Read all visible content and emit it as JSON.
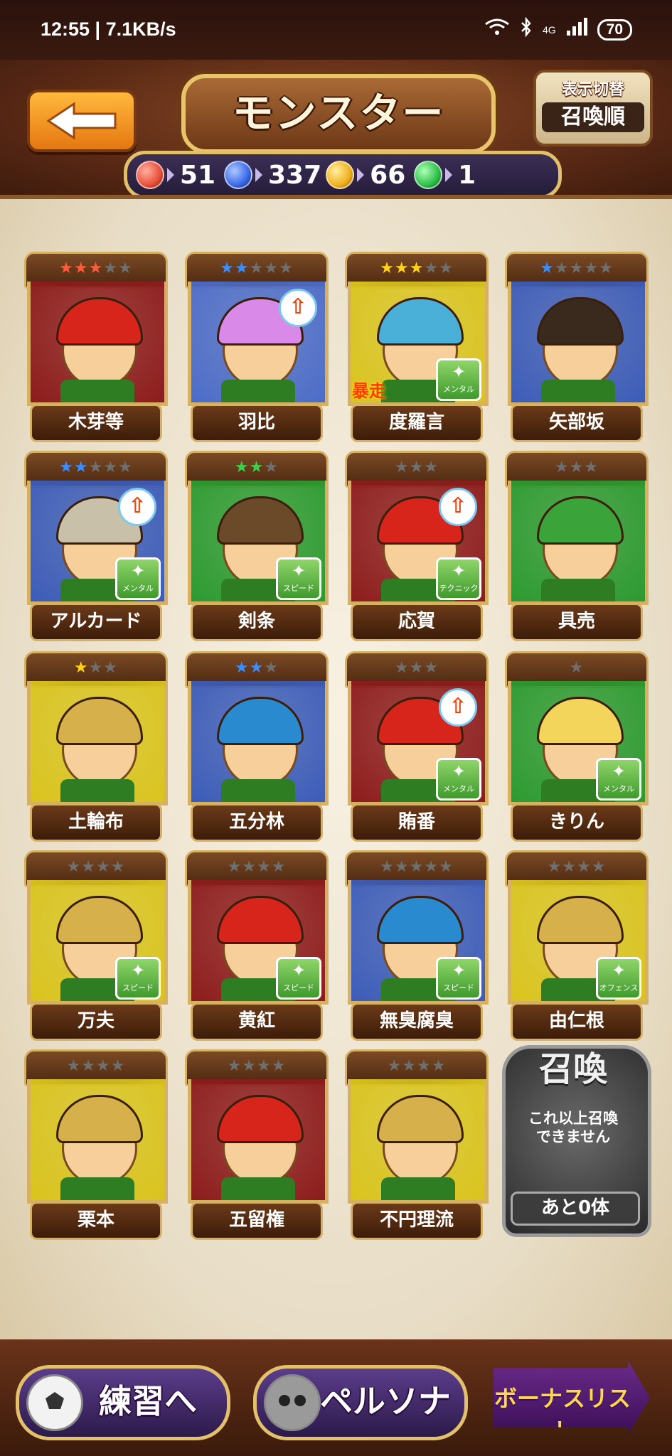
{
  "status_bar": {
    "time": "12:55 | 7.1KB/s",
    "battery": "70",
    "network": "4G"
  },
  "header": {
    "title": "モンスター",
    "sort_label_small": "表示切替",
    "sort_label_big": "召喚順"
  },
  "currencies": [
    {
      "value": "51",
      "color": "#e8503a"
    },
    {
      "value": "337",
      "color": "#3a6ae8"
    },
    {
      "value": "66",
      "color": "#f0b020"
    },
    {
      "value": "1",
      "color": "#2ec04a"
    }
  ],
  "monsters": [
    {
      "name": "木芽等",
      "stars_filled": 3,
      "stars_total": 5,
      "star_color": "#ff5a3a",
      "bg": "#8c1c1c",
      "hair": "#d8251c"
    },
    {
      "name": "羽比",
      "stars_filled": 2,
      "stars_total": 5,
      "star_color": "#3a8cff",
      "bg": "#4c6cc8",
      "hair": "#d98ae8",
      "up": true
    },
    {
      "name": "度羅言",
      "stars_filled": 3,
      "stars_total": 5,
      "star_color": "#ffd21a",
      "bg": "#d9c41e",
      "hair": "#4ab0d8",
      "skill": "メンタル",
      "rampage": "暴走"
    },
    {
      "name": "矢部坂",
      "stars_filled": 1,
      "stars_total": 5,
      "star_color": "#3a8cff",
      "bg": "#3c5cb8",
      "hair": "#3a2a1e"
    },
    {
      "name": "アルカード",
      "stars_filled": 2,
      "stars_total": 5,
      "star_color": "#3a8cff",
      "bg": "#3c5cb8",
      "hair": "#c8c0a8",
      "up": true,
      "skill": "メンタル"
    },
    {
      "name": "剣条",
      "stars_filled": 2,
      "stars_total": 3,
      "star_color": "#3ad24a",
      "bg": "#2c9a30",
      "hair": "#6b4a2a",
      "skill": "スピード"
    },
    {
      "name": "応賀",
      "stars_filled": 0,
      "stars_total": 3,
      "star_color": "#888888",
      "bg": "#8c1c1c",
      "hair": "#d8251c",
      "up": true,
      "skill": "テクニック"
    },
    {
      "name": "具売",
      "stars_filled": 0,
      "stars_total": 3,
      "star_color": "#888888",
      "bg": "#2c9a30",
      "hair": "#3aa43a"
    },
    {
      "name": "土輪布",
      "stars_filled": 1,
      "stars_total": 3,
      "star_color": "#ffd21a",
      "bg": "#d9c41e",
      "hair": "#d6b04a"
    },
    {
      "name": "五分林",
      "stars_filled": 2,
      "stars_total": 3,
      "star_color": "#3a8cff",
      "bg": "#3c5cb8",
      "hair": "#2a8ad0"
    },
    {
      "name": "賄番",
      "stars_filled": 0,
      "stars_total": 3,
      "star_color": "#888888",
      "bg": "#8c1c1c",
      "hair": "#d8251c",
      "up": true,
      "skill": "メンタル"
    },
    {
      "name": "きりん",
      "stars_filled": 0,
      "stars_total": 1,
      "star_color": "#888888",
      "bg": "#2c9a30",
      "hair": "#f2d55a",
      "skill": "メンタル"
    },
    {
      "name": "万夫",
      "stars_filled": 0,
      "stars_total": 4,
      "star_color": "#888888",
      "bg": "#d9c41e",
      "hair": "#d6b04a",
      "skill": "スピード"
    },
    {
      "name": "黄紅",
      "stars_filled": 0,
      "stars_total": 4,
      "star_color": "#888888",
      "bg": "#8c1c1c",
      "hair": "#d8251c",
      "skill": "スピード"
    },
    {
      "name": "無臭腐臭",
      "stars_filled": 0,
      "stars_total": 5,
      "star_color": "#888888",
      "bg": "#3c5cb8",
      "hair": "#2a8ad0",
      "skill": "スピード"
    },
    {
      "name": "由仁根",
      "stars_filled": 0,
      "stars_total": 4,
      "star_color": "#888888",
      "bg": "#d9c41e",
      "hair": "#d6b04a",
      "skill": "オフェンス"
    },
    {
      "name": "栗本",
      "stars_filled": 0,
      "stars_total": 4,
      "star_color": "#888888",
      "bg": "#d9c41e",
      "hair": "#d6b04a"
    },
    {
      "name": "五留権",
      "stars_filled": 0,
      "stars_total": 4,
      "star_color": "#888888",
      "bg": "#8c1c1c",
      "hair": "#d8251c"
    },
    {
      "name": "不円理流",
      "stars_filled": 0,
      "stars_total": 4,
      "star_color": "#888888",
      "bg": "#d9c41e",
      "hair": "#d6b04a"
    }
  ],
  "summon": {
    "title": "召喚",
    "message": "これ以上召喚\nできません",
    "remaining": "あと0体"
  },
  "footer": {
    "practice": "練習へ",
    "persona": "ペルソナ",
    "bonus_list": "ボーナスリスト"
  }
}
